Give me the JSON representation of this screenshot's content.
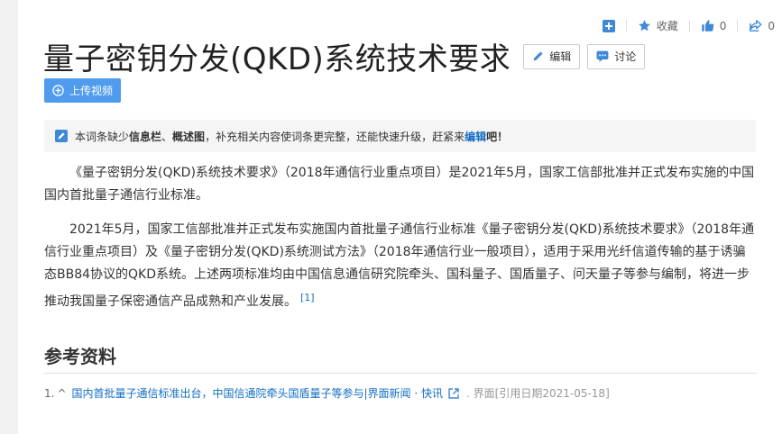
{
  "actions": {
    "favorite_label": "收藏",
    "like_count": "0",
    "share_count": "0"
  },
  "title": "量子密钥分发(QKD)系统技术要求",
  "title_buttons": {
    "edit": "编辑",
    "discuss": "讨论"
  },
  "upload_label": "上传视频",
  "notice": {
    "prefix": "本词条缺少",
    "item1": "信息栏",
    "sep": "、",
    "item2": "概述图",
    "middle": "，补充相关内容使词条更完整，还能快速升级，赶紧来",
    "link": "编辑",
    "suffix": "吧！"
  },
  "paragraphs": {
    "p1": "《量子密钥分发(QKD)系统技术要求》（2018年通信行业重点项目）是2021年5月，国家工信部批准并正式发布实施的中国国内首批量子通信行业标准。",
    "p2": "2021年5月，国家工信部批准并正式发布实施国内首批量子通信行业标准《量子密钥分发(QKD)系统技术要求》（2018年通信行业重点项目）及《量子密钥分发(QKD)系统测试方法》（2018年通信行业一般项目），适用于采用光纤信道传输的基于诱骗态BB84协议的QKD系统。上述两项标准均由中国信息通信研究院牵头、国科量子、国盾量子、问天量子等参与编制，将进一步推动我国量子保密通信产品成熟和产业发展。",
    "p2_ref": "[1]"
  },
  "references": {
    "heading": "参考资料",
    "items": [
      {
        "num": "1.",
        "up": "^",
        "text": "国内首批量子通信标准出台，中国信通院牵头国盾量子等参与|界面新闻 · 快讯",
        "source": ". 界面[引用日期2021-05-18]"
      }
    ]
  },
  "colors": {
    "accent": "#4f9cee",
    "link": "#136ec2",
    "icon_blue": "#3f88d8"
  }
}
